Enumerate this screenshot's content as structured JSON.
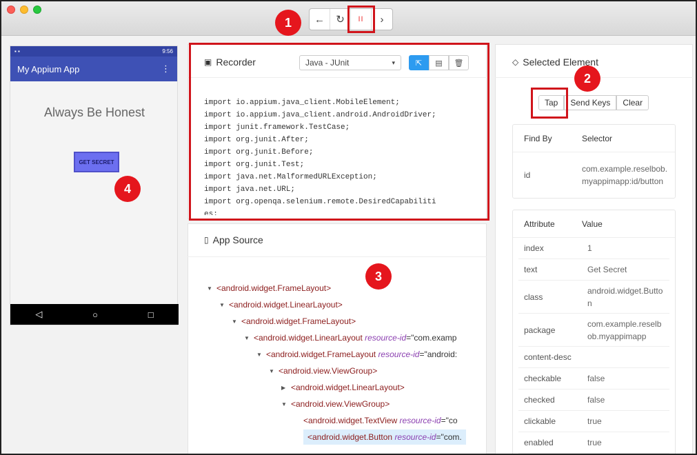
{
  "window": {
    "toolbar": {
      "back_icon": "arrow-left-icon",
      "refresh_icon": "refresh-icon",
      "pause_label": "II",
      "forward_icon": "chevron-right-icon"
    }
  },
  "badges": [
    "1",
    "2",
    "3",
    "4"
  ],
  "device": {
    "status_time": "9:56",
    "app_title": "My Appium App",
    "heading": "Always Be Honest",
    "button_label": "GET SECRET"
  },
  "recorder": {
    "title": "Recorder",
    "language_selected": "Java - JUnit",
    "code_lines": [
      "import io.appium.java_client.MobileElement;",
      "import io.appium.java_client.android.AndroidDriver;",
      "import junit.framework.TestCase;",
      "import org.junit.After;",
      "import org.junit.Before;",
      "import org.junit.Test;",
      "import java.net.MalformedURLException;",
      "import java.net.URL;",
      "import org.openqa.selenium.remote.DesiredCapabiliti",
      "es;"
    ]
  },
  "app_source": {
    "title": "App Source",
    "nodes": [
      {
        "indent": 0,
        "caret": "▼",
        "tag": "<android.widget.FrameLayout>",
        "attr": "",
        "val": ""
      },
      {
        "indent": 1,
        "caret": "▼",
        "tag": "<android.widget.LinearLayout>",
        "attr": "",
        "val": ""
      },
      {
        "indent": 2,
        "caret": "▼",
        "tag": "<android.widget.FrameLayout>",
        "attr": "",
        "val": ""
      },
      {
        "indent": 3,
        "caret": "▼",
        "tag": "<android.widget.LinearLayout",
        "attr": "resource-id",
        "val": "=\"com.examp"
      },
      {
        "indent": 4,
        "caret": "▼",
        "tag": "<android.widget.FrameLayout",
        "attr": "resource-id",
        "val": "=\"android:"
      },
      {
        "indent": 5,
        "caret": "▼",
        "tag": "<android.view.ViewGroup>",
        "attr": "",
        "val": ""
      },
      {
        "indent": 6,
        "caret": "▶",
        "tag": "<android.widget.LinearLayout>",
        "attr": "",
        "val": ""
      },
      {
        "indent": 6,
        "caret": "▼",
        "tag": "<android.view.ViewGroup>",
        "attr": "",
        "val": ""
      },
      {
        "indent": 7,
        "caret": "",
        "tag": "<android.widget.TextView",
        "attr": "resource-id",
        "val": "=\"co"
      },
      {
        "indent": 7,
        "caret": "",
        "tag": "<android.widget.Button",
        "attr": "resource-id",
        "val": "=\"com.",
        "selected": true
      }
    ]
  },
  "selected_element": {
    "title": "Selected Element",
    "actions": [
      "Tap",
      "Send Keys",
      "Clear"
    ],
    "find_by_header": [
      "Find By",
      "Selector"
    ],
    "find_by_rows": [
      {
        "key": "id",
        "value": "com.example.reselbob.myappimapp:id/button"
      }
    ],
    "attr_header": [
      "Attribute",
      "Value"
    ],
    "attributes": [
      {
        "key": "index",
        "value": "1"
      },
      {
        "key": "text",
        "value": "Get Secret"
      },
      {
        "key": "class",
        "value": "android.widget.Button"
      },
      {
        "key": "package",
        "value": "com.example.reselbob.myappimapp"
      },
      {
        "key": "content-desc",
        "value": ""
      },
      {
        "key": "checkable",
        "value": "false"
      },
      {
        "key": "checked",
        "value": "false"
      },
      {
        "key": "clickable",
        "value": "true"
      },
      {
        "key": "enabled",
        "value": "true"
      }
    ]
  }
}
